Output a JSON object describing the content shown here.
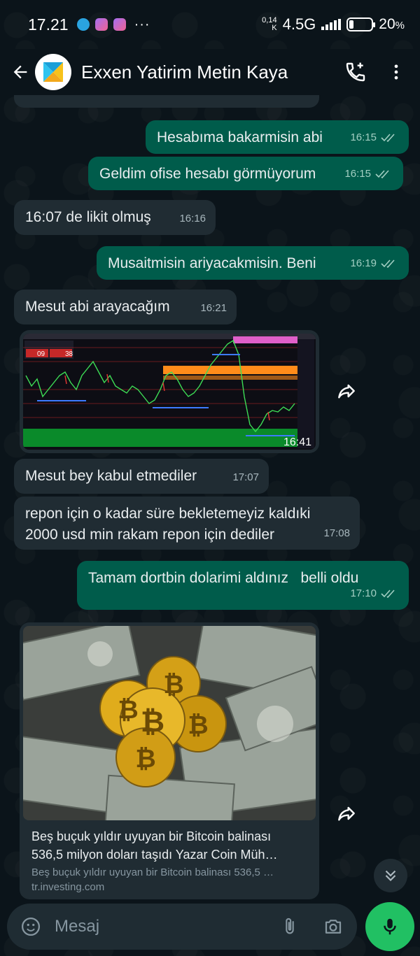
{
  "status_bar": {
    "time": "17.21",
    "speed_top": "0,14",
    "speed_bottom": "K",
    "network": "4.5G",
    "battery_text": "20",
    "battery_unit": "%",
    "battery_level": 0.2
  },
  "header": {
    "title": "Exxen Yatirim Metin Kaya"
  },
  "messages": [
    {
      "text": "Hesabıma bakarmisin abi",
      "time": "16:15"
    },
    {
      "text": "Geldim ofise hesabı görmüyorum",
      "time": "16:15"
    },
    {
      "text": "16:07 de likit olmuş",
      "time": "16:16"
    },
    {
      "text": "Musaitmisin ariyacakmisin. Beni",
      "time": "16:19"
    },
    {
      "text": "Mesut abi arayacağım",
      "time": "16:21"
    },
    {
      "text": "Mesut bey kabul etmediler",
      "time": "17:07"
    },
    {
      "line1": "repon için o kadar süre bekletemeyiz kaldıki",
      "line2": "2000 usd min rakam repon için dediler",
      "time": "17:08"
    },
    {
      "text": "Tamam dortbin dolarimi aldınız   belli oldu",
      "time": "17:10"
    }
  ],
  "chart_image": {
    "time": "16:41",
    "box_left_value": "09",
    "box_right_value": "38"
  },
  "link_preview": {
    "title_line1": "Beş buçuk yıldır uyuyan bir Bitcoin balinası",
    "title_line2": "536,5 milyon doları taşıdı Yazar Coin Müh…",
    "description": "Beş buçuk yıldır uyuyan bir Bitcoin balinası 536,5 …",
    "domain": "tr.investing.com"
  },
  "composer": {
    "placeholder": "Mesaj"
  },
  "colors": {
    "outgoing_bubble": "#005c4b",
    "incoming_bubble": "#202c33",
    "mic_button": "#21c063",
    "background": "#0b141a"
  }
}
